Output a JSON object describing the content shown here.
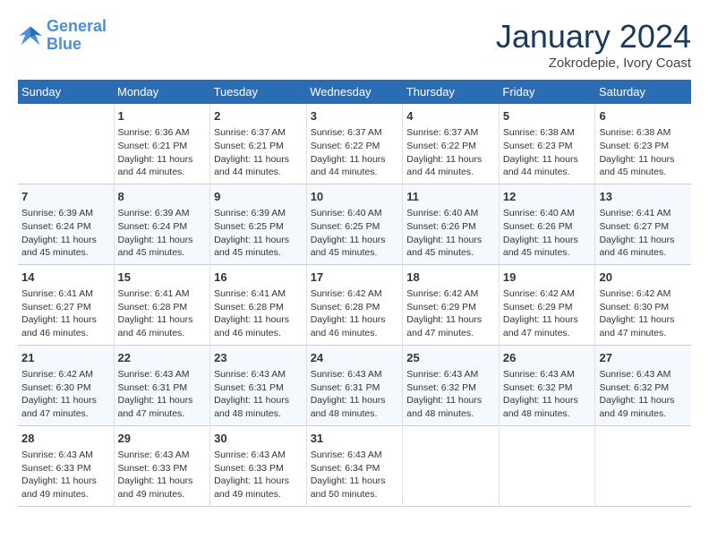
{
  "header": {
    "logo_general": "General",
    "logo_blue": "Blue",
    "month": "January 2024",
    "location": "Zokrodepie, Ivory Coast"
  },
  "days_of_week": [
    "Sunday",
    "Monday",
    "Tuesday",
    "Wednesday",
    "Thursday",
    "Friday",
    "Saturday"
  ],
  "weeks": [
    [
      {
        "day": "",
        "info": ""
      },
      {
        "day": "1",
        "info": "Sunrise: 6:36 AM\nSunset: 6:21 PM\nDaylight: 11 hours\nand 44 minutes."
      },
      {
        "day": "2",
        "info": "Sunrise: 6:37 AM\nSunset: 6:21 PM\nDaylight: 11 hours\nand 44 minutes."
      },
      {
        "day": "3",
        "info": "Sunrise: 6:37 AM\nSunset: 6:22 PM\nDaylight: 11 hours\nand 44 minutes."
      },
      {
        "day": "4",
        "info": "Sunrise: 6:37 AM\nSunset: 6:22 PM\nDaylight: 11 hours\nand 44 minutes."
      },
      {
        "day": "5",
        "info": "Sunrise: 6:38 AM\nSunset: 6:23 PM\nDaylight: 11 hours\nand 44 minutes."
      },
      {
        "day": "6",
        "info": "Sunrise: 6:38 AM\nSunset: 6:23 PM\nDaylight: 11 hours\nand 45 minutes."
      }
    ],
    [
      {
        "day": "7",
        "info": "Sunrise: 6:39 AM\nSunset: 6:24 PM\nDaylight: 11 hours\nand 45 minutes."
      },
      {
        "day": "8",
        "info": "Sunrise: 6:39 AM\nSunset: 6:24 PM\nDaylight: 11 hours\nand 45 minutes."
      },
      {
        "day": "9",
        "info": "Sunrise: 6:39 AM\nSunset: 6:25 PM\nDaylight: 11 hours\nand 45 minutes."
      },
      {
        "day": "10",
        "info": "Sunrise: 6:40 AM\nSunset: 6:25 PM\nDaylight: 11 hours\nand 45 minutes."
      },
      {
        "day": "11",
        "info": "Sunrise: 6:40 AM\nSunset: 6:26 PM\nDaylight: 11 hours\nand 45 minutes."
      },
      {
        "day": "12",
        "info": "Sunrise: 6:40 AM\nSunset: 6:26 PM\nDaylight: 11 hours\nand 45 minutes."
      },
      {
        "day": "13",
        "info": "Sunrise: 6:41 AM\nSunset: 6:27 PM\nDaylight: 11 hours\nand 46 minutes."
      }
    ],
    [
      {
        "day": "14",
        "info": "Sunrise: 6:41 AM\nSunset: 6:27 PM\nDaylight: 11 hours\nand 46 minutes."
      },
      {
        "day": "15",
        "info": "Sunrise: 6:41 AM\nSunset: 6:28 PM\nDaylight: 11 hours\nand 46 minutes."
      },
      {
        "day": "16",
        "info": "Sunrise: 6:41 AM\nSunset: 6:28 PM\nDaylight: 11 hours\nand 46 minutes."
      },
      {
        "day": "17",
        "info": "Sunrise: 6:42 AM\nSunset: 6:28 PM\nDaylight: 11 hours\nand 46 minutes."
      },
      {
        "day": "18",
        "info": "Sunrise: 6:42 AM\nSunset: 6:29 PM\nDaylight: 11 hours\nand 47 minutes."
      },
      {
        "day": "19",
        "info": "Sunrise: 6:42 AM\nSunset: 6:29 PM\nDaylight: 11 hours\nand 47 minutes."
      },
      {
        "day": "20",
        "info": "Sunrise: 6:42 AM\nSunset: 6:30 PM\nDaylight: 11 hours\nand 47 minutes."
      }
    ],
    [
      {
        "day": "21",
        "info": "Sunrise: 6:42 AM\nSunset: 6:30 PM\nDaylight: 11 hours\nand 47 minutes."
      },
      {
        "day": "22",
        "info": "Sunrise: 6:43 AM\nSunset: 6:31 PM\nDaylight: 11 hours\nand 47 minutes."
      },
      {
        "day": "23",
        "info": "Sunrise: 6:43 AM\nSunset: 6:31 PM\nDaylight: 11 hours\nand 48 minutes."
      },
      {
        "day": "24",
        "info": "Sunrise: 6:43 AM\nSunset: 6:31 PM\nDaylight: 11 hours\nand 48 minutes."
      },
      {
        "day": "25",
        "info": "Sunrise: 6:43 AM\nSunset: 6:32 PM\nDaylight: 11 hours\nand 48 minutes."
      },
      {
        "day": "26",
        "info": "Sunrise: 6:43 AM\nSunset: 6:32 PM\nDaylight: 11 hours\nand 48 minutes."
      },
      {
        "day": "27",
        "info": "Sunrise: 6:43 AM\nSunset: 6:32 PM\nDaylight: 11 hours\nand 49 minutes."
      }
    ],
    [
      {
        "day": "28",
        "info": "Sunrise: 6:43 AM\nSunset: 6:33 PM\nDaylight: 11 hours\nand 49 minutes."
      },
      {
        "day": "29",
        "info": "Sunrise: 6:43 AM\nSunset: 6:33 PM\nDaylight: 11 hours\nand 49 minutes."
      },
      {
        "day": "30",
        "info": "Sunrise: 6:43 AM\nSunset: 6:33 PM\nDaylight: 11 hours\nand 49 minutes."
      },
      {
        "day": "31",
        "info": "Sunrise: 6:43 AM\nSunset: 6:34 PM\nDaylight: 11 hours\nand 50 minutes."
      },
      {
        "day": "",
        "info": ""
      },
      {
        "day": "",
        "info": ""
      },
      {
        "day": "",
        "info": ""
      }
    ]
  ]
}
